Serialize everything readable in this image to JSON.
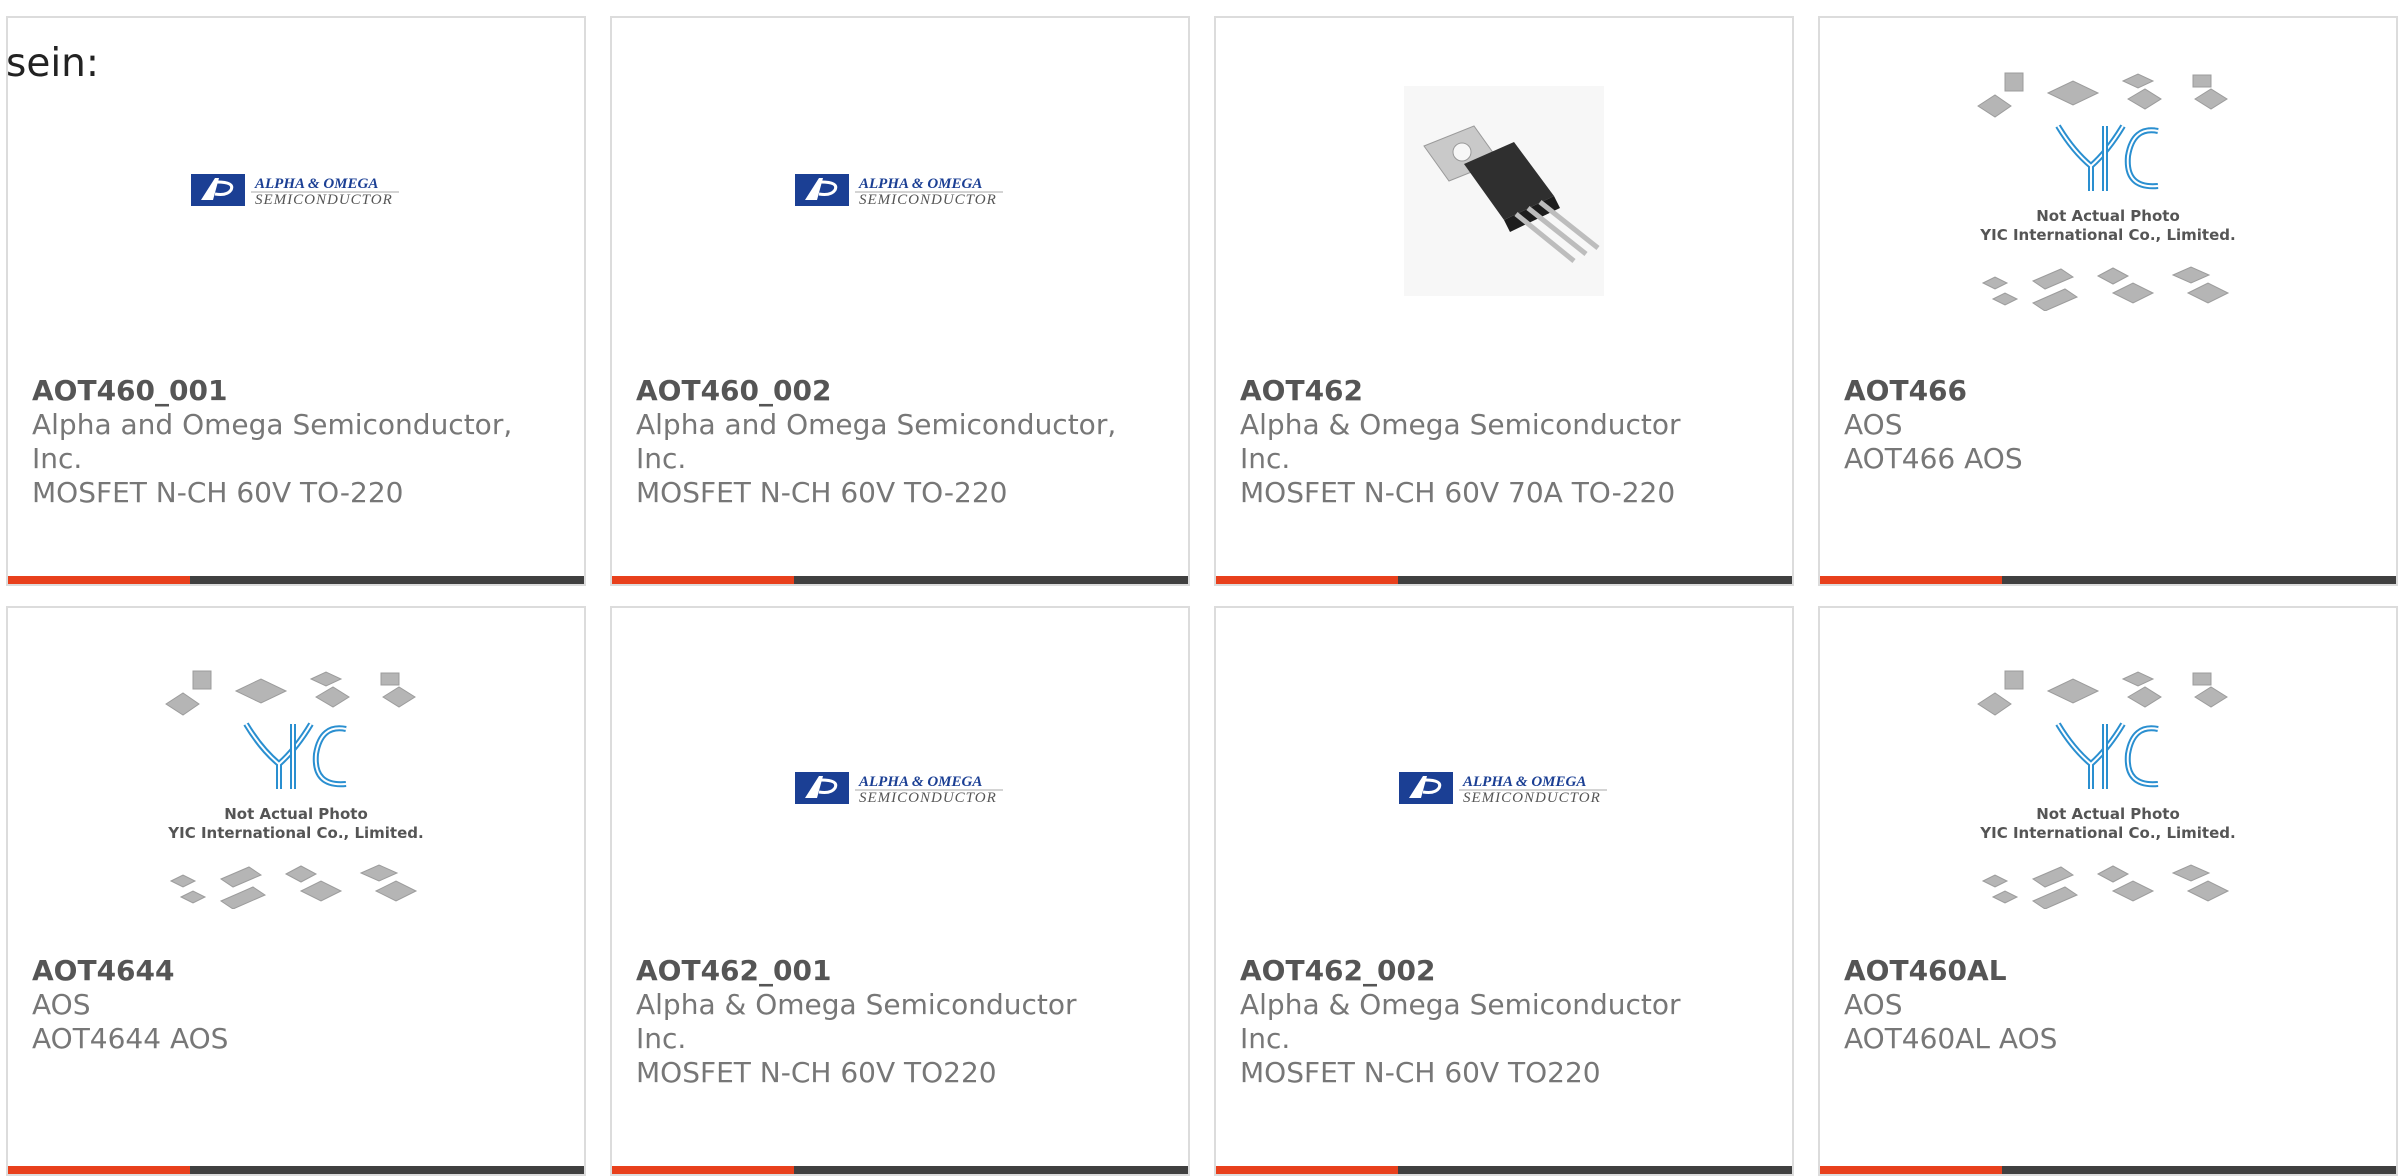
{
  "intro_text": "sein:",
  "accent_color": "#e8401c",
  "dark_bar_color": "#404040",
  "products": [
    {
      "part": "AOT460_001",
      "manufacturer": "Alpha and Omega Semiconductor,\nInc.",
      "description": "MOSFET N-CH 60V TO-220",
      "image": "aos-logo"
    },
    {
      "part": "AOT460_002",
      "manufacturer": "Alpha and Omega Semiconductor,\nInc.",
      "description": "MOSFET N-CH 60V TO-220",
      "image": "aos-logo"
    },
    {
      "part": "AOT462",
      "manufacturer": "Alpha & Omega Semiconductor\nInc.",
      "description": "MOSFET N-CH 60V 70A TO-220",
      "image": "to220-photo"
    },
    {
      "part": "AOT466",
      "manufacturer": "AOS",
      "description": "AOT466 AOS",
      "image": "yic-placeholder"
    },
    {
      "part": "AOT4644",
      "manufacturer": "AOS",
      "description": "AOT4644 AOS",
      "image": "yic-placeholder"
    },
    {
      "part": "AOT462_001",
      "manufacturer": "Alpha & Omega Semiconductor\nInc.",
      "description": "MOSFET N-CH 60V TO220",
      "image": "aos-logo"
    },
    {
      "part": "AOT462_002",
      "manufacturer": "Alpha & Omega Semiconductor\nInc.",
      "description": "MOSFET N-CH 60V TO220",
      "image": "aos-logo"
    },
    {
      "part": "AOT460AL",
      "manufacturer": "AOS",
      "description": "AOT460AL AOS",
      "image": "yic-placeholder"
    }
  ],
  "logos": {
    "aos_line1": "ALPHA & OMEGA",
    "aos_line2": "SEMICONDUCTOR"
  },
  "yic": {
    "brand": "YIC",
    "caption1": "Not Actual Photo",
    "caption2": "YIC International Co., Limited."
  }
}
